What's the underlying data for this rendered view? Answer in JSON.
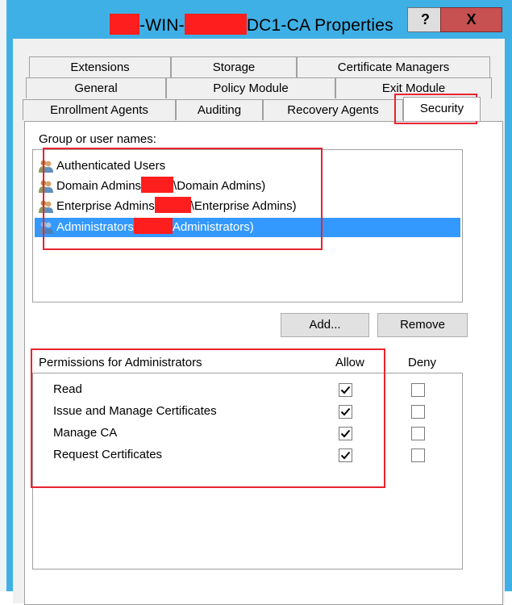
{
  "window": {
    "title_prefix": "-WIN-",
    "title_suffix": "DC1-CA Properties",
    "help_label": "?",
    "close_label": "X"
  },
  "tabs": {
    "row1": [
      "Extensions",
      "Storage",
      "Certificate Managers"
    ],
    "row2": [
      "General",
      "Policy Module",
      "Exit Module"
    ],
    "row3": [
      "Enrollment Agents",
      "Auditing",
      "Recovery Agents",
      "Security"
    ],
    "active": "Security"
  },
  "security": {
    "group_label": "Group or user names:",
    "users": [
      {
        "name_a": "Authenticated Users",
        "name_b": "",
        "selected": false
      },
      {
        "name_a": "Domain Admins",
        "name_b": "\\Domain Admins)",
        "selected": false
      },
      {
        "name_a": "Enterprise Admins",
        "name_b": "\\Enterprise Admins)",
        "selected": false
      },
      {
        "name_a": "Administrators",
        "name_b": "Administrators)",
        "selected": true
      }
    ],
    "add_button": "Add...",
    "remove_button": "Remove",
    "permissions_label": "Permissions for Administrators",
    "allow_header": "Allow",
    "deny_header": "Deny",
    "permissions": [
      {
        "name": "Read",
        "allow": true,
        "deny": false
      },
      {
        "name": "Issue and Manage Certificates",
        "allow": true,
        "deny": false
      },
      {
        "name": "Manage CA",
        "allow": true,
        "deny": false
      },
      {
        "name": "Request Certificates",
        "allow": true,
        "deny": false
      }
    ]
  },
  "colors": {
    "accent_titlebar": "#3fb0e6",
    "selection": "#3399ff",
    "annotation_red": "#e8242f",
    "redaction_red": "#ff1e1e",
    "close_button": "#c75050"
  },
  "icons": {
    "user_group": "users-group-icon",
    "checkmark": "checkmark-icon"
  }
}
